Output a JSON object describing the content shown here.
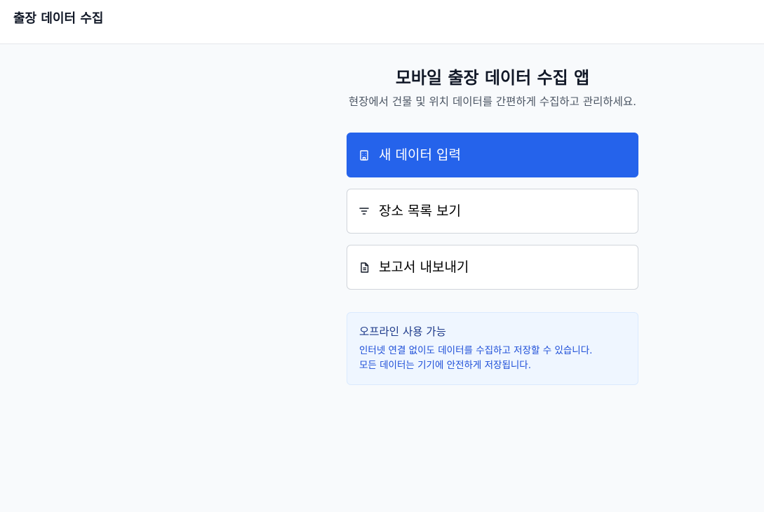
{
  "header": {
    "app_title": "출장 데이터 수집"
  },
  "main": {
    "title": "모바일 출장 데이터 수집 앱",
    "subtitle": "현장에서 건물 및 위치 데이터를 간편하게 수집하고 관리하세요."
  },
  "actions": [
    {
      "label": "새 데이터 입력",
      "icon": "building-icon",
      "variant": "primary"
    },
    {
      "label": "장소 목록 보기",
      "icon": "filter-icon",
      "variant": "outline"
    },
    {
      "label": "보고서 내보내기",
      "icon": "document-icon",
      "variant": "outline"
    }
  ],
  "info": {
    "title": "오프라인 사용 가능",
    "line1": "인터넷 연결 없이도 데이터를 수집하고 저장할 수 있습니다.",
    "line2": "모든 데이터는 기기에 안전하게 저장됩니다."
  },
  "colors": {
    "primary": "#2563eb",
    "background": "#f8fafc",
    "info_bg": "#eff6ff",
    "info_title": "#1e3a8a",
    "info_text": "#1d4ed8"
  }
}
